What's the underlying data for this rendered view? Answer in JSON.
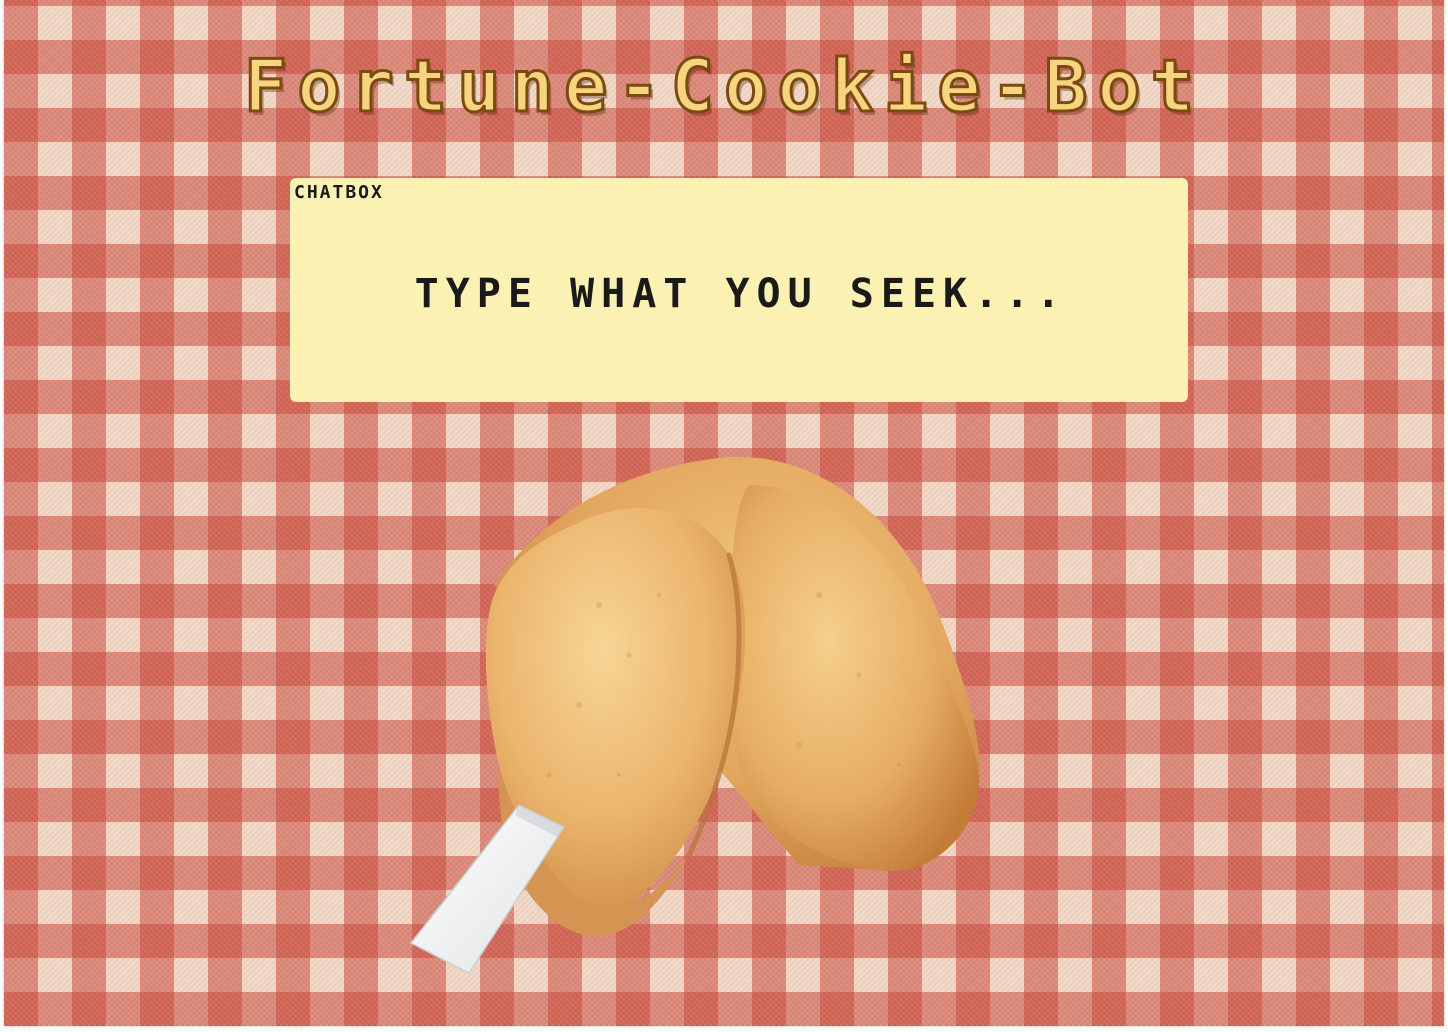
{
  "app": {
    "title": "Fortune-Cookie-Bot"
  },
  "chatbox": {
    "label": "CHATBOX",
    "value": "",
    "placeholder": "TYPE WHAT YOU SEEK..."
  },
  "cookie": {
    "icon": "fortune-cookie-icon"
  },
  "colors": {
    "tablecloth_red": "#cc483a",
    "tablecloth_light": "#f4d9c6",
    "title_fill": "#f6d57e",
    "title_outline": "#7a4a12",
    "chatbox_bg": "#faf1b3",
    "text": "#1a1a1a"
  }
}
